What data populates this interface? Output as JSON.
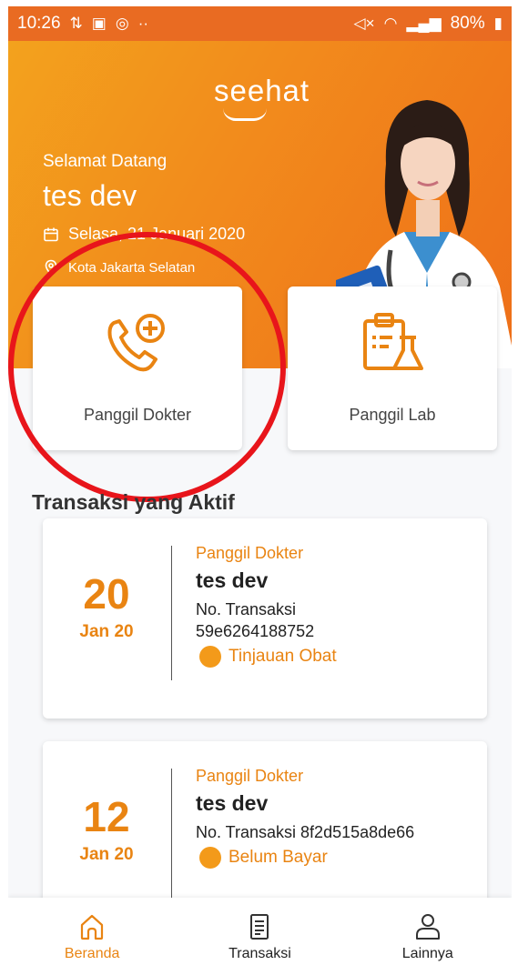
{
  "status_bar": {
    "time": "10:26",
    "left_icons": [
      "sync-icon",
      "image-icon",
      "whatsapp-icon",
      "more-dots-icon"
    ],
    "battery": "80%"
  },
  "hero": {
    "brand": "seehat",
    "greeting": "Selamat Datang",
    "username": "tes dev",
    "date": "Selasa, 21 Januari 2020",
    "location": "Kota Jakarta Selatan"
  },
  "services": [
    {
      "label": "Panggil Dokter",
      "icon": "phone-plus-icon"
    },
    {
      "label": "Panggil Lab",
      "icon": "lab-clipboard-icon"
    }
  ],
  "section_title": "Transaksi yang Aktif",
  "transactions": [
    {
      "day": "20",
      "month": "Jan 20",
      "service": "Panggil Dokter",
      "name": "tes dev",
      "number": "No. Transaksi 59e6264188752",
      "status": "Tinjauan Obat"
    },
    {
      "day": "12",
      "month": "Jan 20",
      "service": "Panggil Dokter",
      "name": "tes dev",
      "number": "No. Transaksi 8f2d515a8de66",
      "status": "Belum Bayar"
    }
  ],
  "nav": [
    {
      "label": "Beranda",
      "icon": "home-icon",
      "active": true
    },
    {
      "label": "Transaksi",
      "icon": "document-icon",
      "active": false
    },
    {
      "label": "Lainnya",
      "icon": "user-icon",
      "active": false
    }
  ],
  "colors": {
    "accent": "#e98412",
    "hero_start": "#f3a21d",
    "hero_end": "#ee6f19",
    "highlight": "#e8151b"
  }
}
